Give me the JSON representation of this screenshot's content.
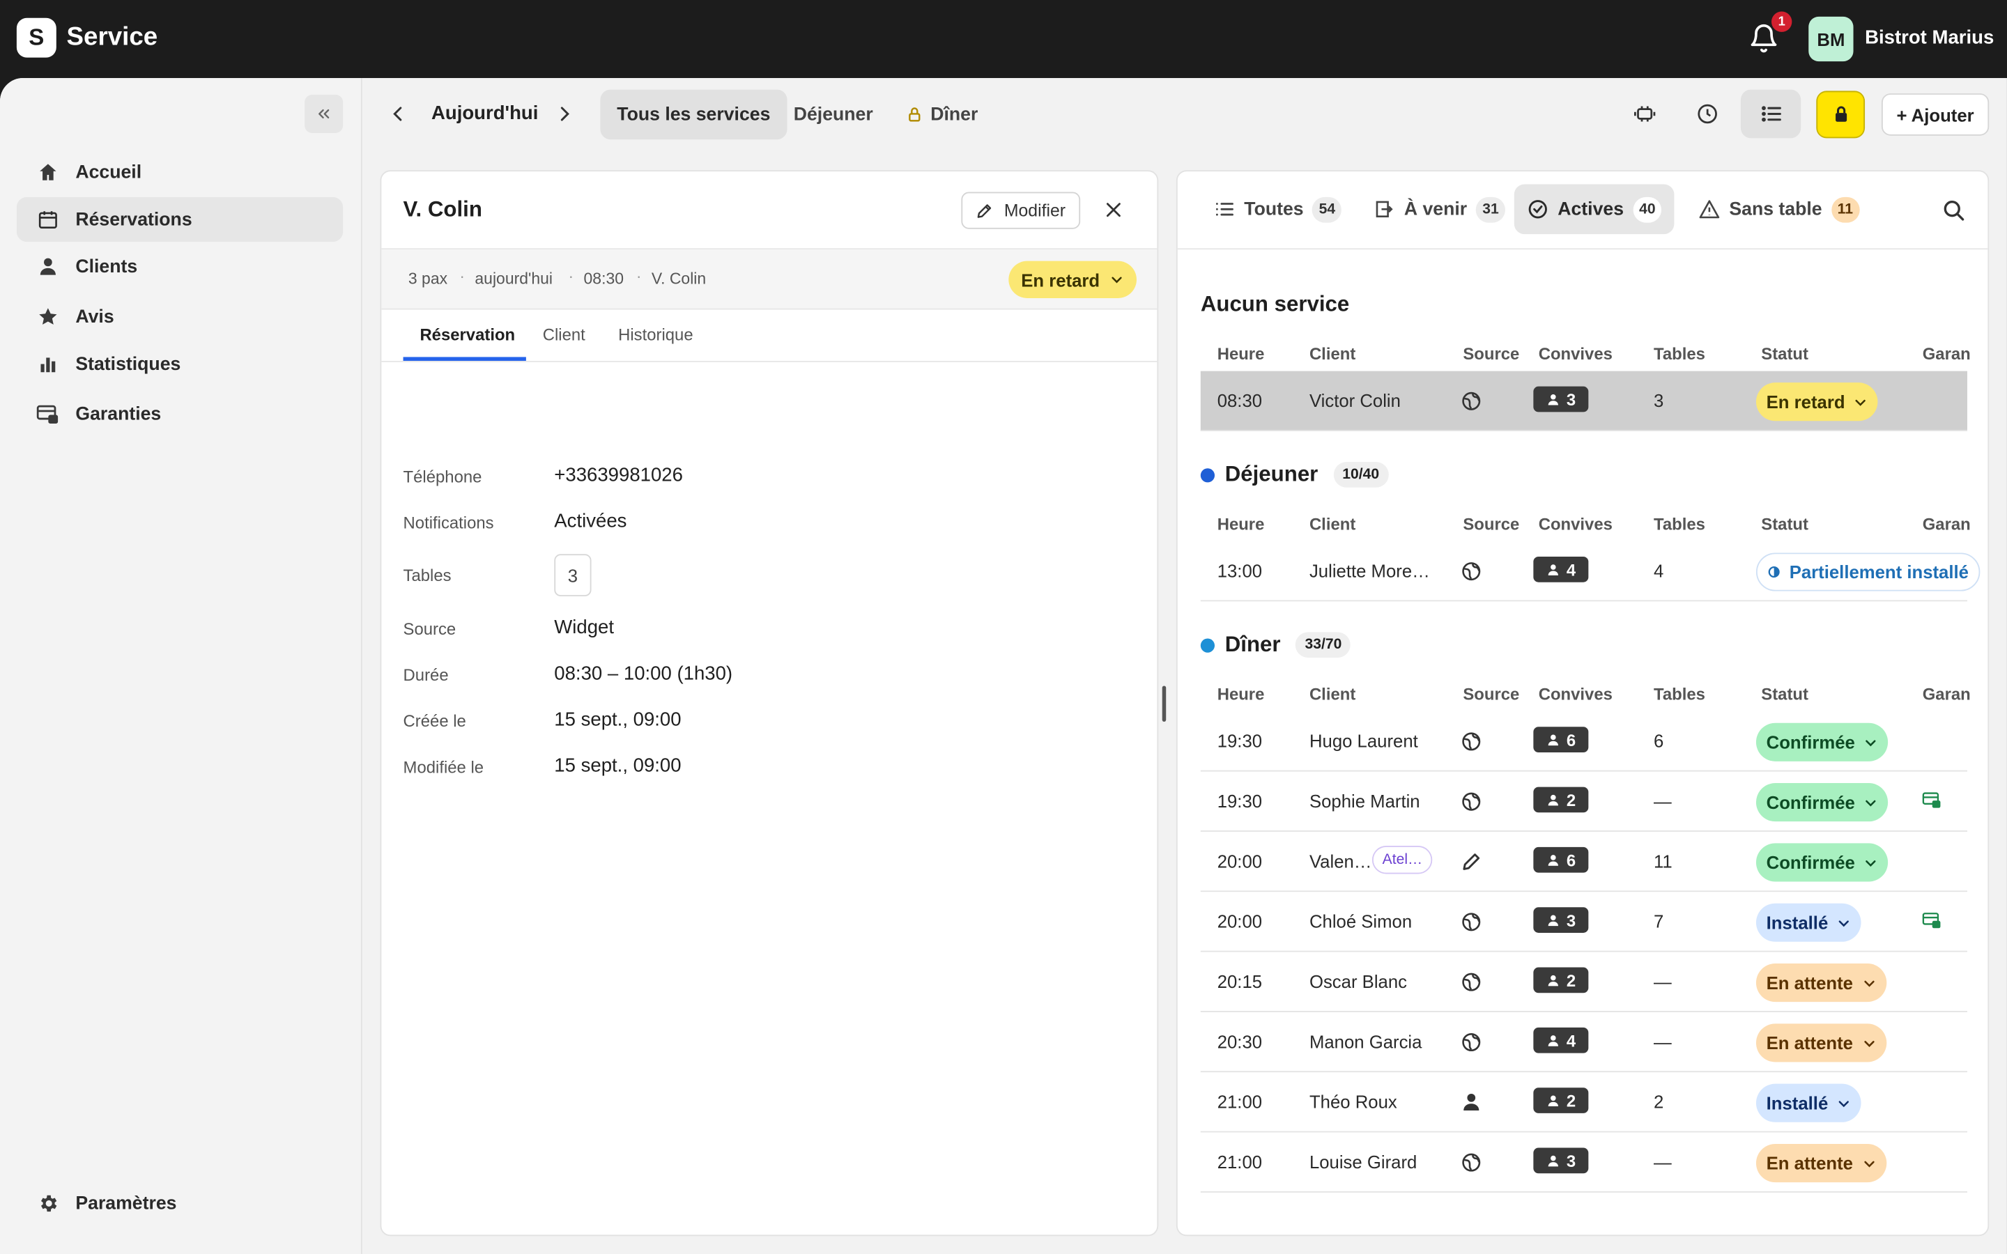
{
  "app": {
    "logo_letter": "S",
    "name": "Service",
    "notifications_count": "1",
    "avatar_initials": "BM",
    "account_name": "Bistrot Marius"
  },
  "sidebar": {
    "items": [
      {
        "label": "Accueil",
        "icon": "home-icon"
      },
      {
        "label": "Réservations",
        "icon": "calendar-icon",
        "active": true
      },
      {
        "label": "Clients",
        "icon": "user-icon"
      },
      {
        "label": "Avis",
        "icon": "star-icon"
      },
      {
        "label": "Statistiques",
        "icon": "bar-chart-icon"
      },
      {
        "label": "Garanties",
        "icon": "card-lock-icon"
      }
    ],
    "settings_label": "Paramètres"
  },
  "toolbar": {
    "date_label": "Aujourd'hui",
    "services": [
      "Tous les services",
      "Déjeuner",
      "Dîner"
    ],
    "add_label": "+ Ajouter"
  },
  "detail": {
    "title": "V. Colin",
    "modify_label": "Modifier",
    "meta": [
      "3 pax",
      "aujourd'hui",
      "08:30",
      "V. Colin"
    ],
    "status_label": "En retard",
    "tabs": [
      "Réservation",
      "Client",
      "Historique"
    ],
    "fields": [
      {
        "label": "Téléphone",
        "value": "+33639981026"
      },
      {
        "label": "Notifications",
        "value": "Activées"
      },
      {
        "label": "Tables",
        "value": "3"
      },
      {
        "label": "Source",
        "value": "Widget"
      },
      {
        "label": "Durée",
        "value": "08:30 – 10:00 (1h30)"
      },
      {
        "label": "Créée le",
        "value": "15 sept., 09:00"
      },
      {
        "label": "Modifiée le",
        "value": "15 sept., 09:00"
      }
    ]
  },
  "list": {
    "tabs": [
      {
        "label": "Toutes",
        "count": "54"
      },
      {
        "label": "À venir",
        "count": "31"
      },
      {
        "label": "Actives",
        "count": "40"
      },
      {
        "label": "Sans table",
        "count": "11"
      }
    ],
    "columns": [
      "Heure",
      "Client",
      "Source",
      "Convives",
      "Tables",
      "Statut",
      "Garan"
    ],
    "sections": [
      {
        "title": "Aucun service",
        "rows": [
          {
            "time": "08:30",
            "client": "Victor Colin",
            "source": "globe-icon",
            "pax": "3",
            "tables": "3",
            "status": "En retard",
            "tone": "yellow"
          }
        ]
      },
      {
        "title": "Déjeuner",
        "count": "10/40",
        "dot_color": "#1f5fd6",
        "rows": [
          {
            "time": "13:00",
            "client": "Juliette More…",
            "source": "globe-icon",
            "pax": "4",
            "tables": "4",
            "status": "Partiellement installé",
            "tone": "partial"
          }
        ]
      },
      {
        "title": "Dîner",
        "count": "33/70",
        "dot_color": "#1e90d6",
        "rows": [
          {
            "time": "19:30",
            "client": "Hugo Laurent",
            "source": "globe-icon",
            "pax": "6",
            "tables": "6",
            "status": "Confirmée",
            "tone": "green"
          },
          {
            "time": "19:30",
            "client": "Sophie Martin",
            "source": "globe-icon",
            "pax": "2",
            "tables": "—",
            "status": "Confirmée",
            "tone": "green",
            "guarantee": true
          },
          {
            "time": "20:00",
            "client": "Valen…",
            "tag": "Atel…",
            "source": "pencil-icon",
            "pax": "6",
            "tables": "11",
            "status": "Confirmée",
            "tone": "green"
          },
          {
            "time": "20:00",
            "client": "Chloé Simon",
            "source": "globe-icon",
            "pax": "3",
            "tables": "7",
            "status": "Installé",
            "tone": "blue",
            "guarantee": true
          },
          {
            "time": "20:15",
            "client": "Oscar Blanc",
            "source": "globe-icon",
            "pax": "2",
            "tables": "—",
            "status": "En attente",
            "tone": "orange"
          },
          {
            "time": "20:30",
            "client": "Manon Garcia",
            "source": "globe-icon",
            "pax": "4",
            "tables": "—",
            "status": "En attente",
            "tone": "orange"
          },
          {
            "time": "21:00",
            "client": "Théo Roux",
            "source": "person-icon",
            "pax": "2",
            "tables": "2",
            "status": "Installé",
            "tone": "blue"
          },
          {
            "time": "21:00",
            "client": "Louise Girard",
            "source": "globe-icon",
            "pax": "3",
            "tables": "—",
            "status": "En attente",
            "tone": "orange"
          }
        ]
      }
    ]
  },
  "colors": {
    "accent_blue": "#2563eb",
    "lock_yellow": "#ffe400",
    "late_yellow": "#fbe773",
    "confirmed_green": "#a8f0c0",
    "seated_blue": "#d4e6ff",
    "waiting_orange": "#fddcb0"
  }
}
